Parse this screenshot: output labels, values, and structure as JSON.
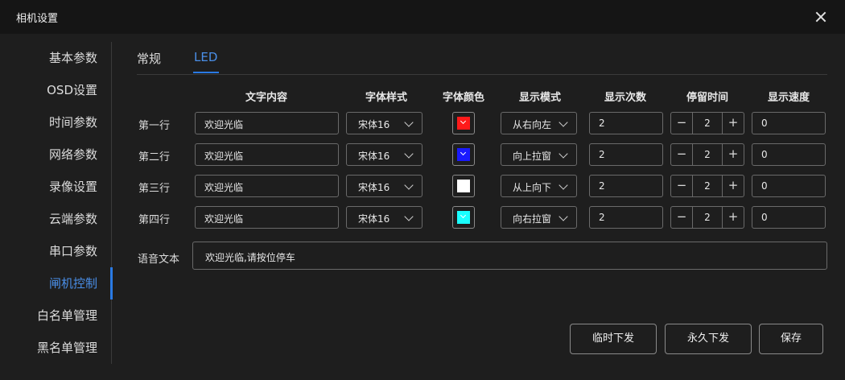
{
  "window": {
    "title": "相机设置"
  },
  "sidebar": {
    "items": [
      "基本参数",
      "OSD设置",
      "时间参数",
      "网络参数",
      "录像设置",
      "云端参数",
      "串口参数",
      "闸机控制",
      "白名单管理",
      "黑名单管理"
    ],
    "active_index": 7
  },
  "tabs": [
    "常规",
    "LED"
  ],
  "table": {
    "headers": [
      "文字内容",
      "字体样式",
      "字体颜色",
      "显示模式",
      "显示次数",
      "停留时间",
      "显示速度"
    ],
    "rows": [
      {
        "label": "第一行",
        "text": "欢迎光临",
        "font": "宋体16",
        "color": "#ff1a1a",
        "mode": "从右向左",
        "count": "2",
        "stay": "2",
        "speed": "0"
      },
      {
        "label": "第二行",
        "text": "欢迎光临",
        "font": "宋体16",
        "color": "#1a1aff",
        "mode": "向上拉窗",
        "count": "2",
        "stay": "2",
        "speed": "0"
      },
      {
        "label": "第三行",
        "text": "欢迎光临",
        "font": "宋体16",
        "color": "#ffffff",
        "mode": "从上向下",
        "count": "2",
        "stay": "2",
        "speed": "0"
      },
      {
        "label": "第四行",
        "text": "欢迎光临",
        "font": "宋体16",
        "color": "#1affff",
        "mode": "向右拉窗",
        "count": "2",
        "stay": "2",
        "speed": "0"
      }
    ]
  },
  "voice": {
    "label": "语音文本",
    "value": "欢迎光临,请按位停车"
  },
  "buttons": {
    "temp": "临时下发",
    "permanent": "永久下发",
    "save": "保存"
  },
  "icons": {
    "close": "close-icon",
    "dropdown": "chevron-down-icon",
    "minus": "minus-icon",
    "plus": "plus-icon"
  },
  "colors": {
    "accent": "#2a7ae4",
    "background": "#1e1e1e",
    "titlebar": "#151515"
  }
}
